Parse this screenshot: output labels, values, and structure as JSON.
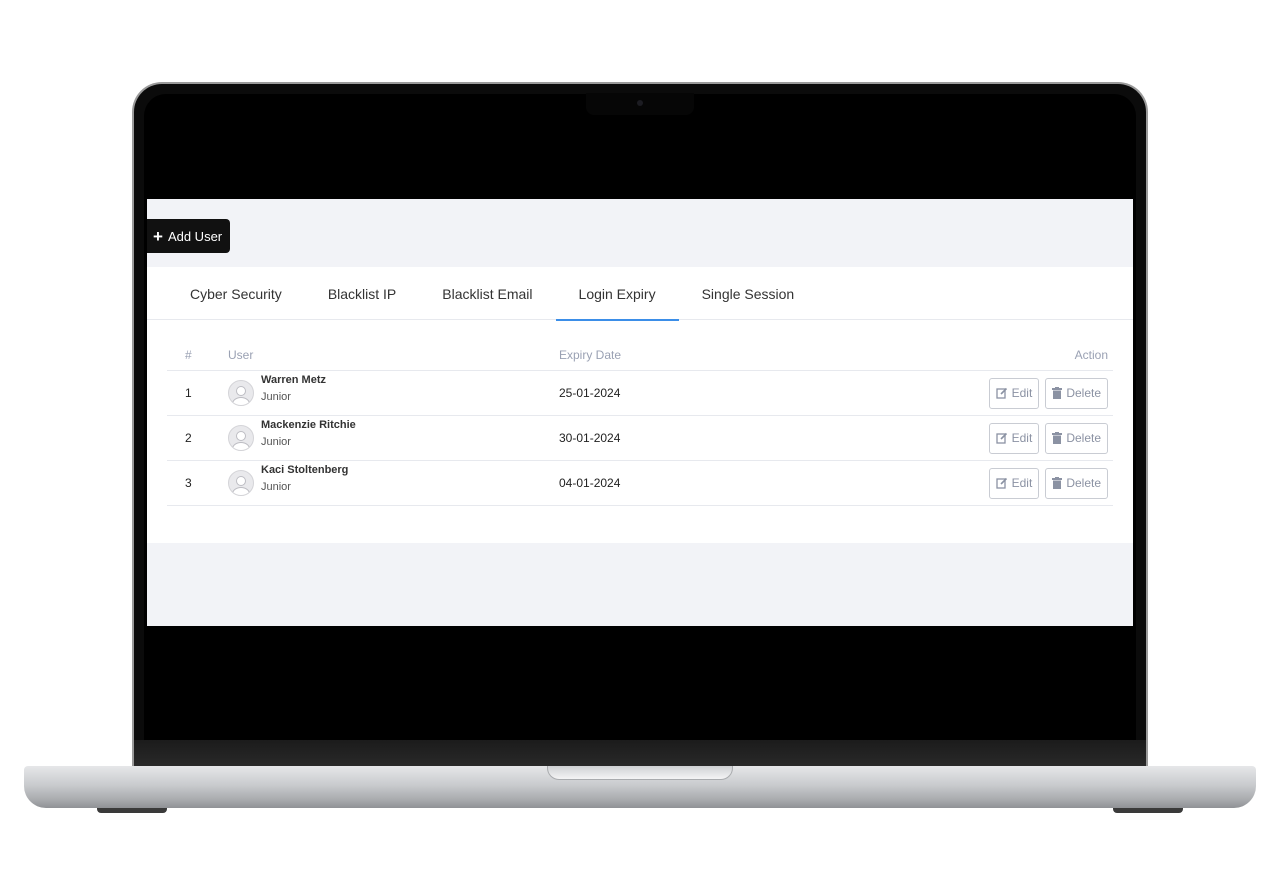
{
  "toolbar": {
    "add_user_label": "Add User",
    "add_user_icon": "plus-icon"
  },
  "tabs": [
    {
      "label": "Cyber Security",
      "active": false
    },
    {
      "label": "Blacklist IP",
      "active": false
    },
    {
      "label": "Blacklist Email",
      "active": false
    },
    {
      "label": "Login Expiry",
      "active": true
    },
    {
      "label": "Single Session",
      "active": false
    }
  ],
  "table": {
    "headers": {
      "num": "#",
      "user": "User",
      "expiry": "Expiry Date",
      "action": "Action"
    },
    "rows": [
      {
        "num": "1",
        "name": "Warren Metz",
        "role": "Junior",
        "expiry": "25-01-2024",
        "edit": "Edit",
        "delete": "Delete"
      },
      {
        "num": "2",
        "name": "Mackenzie Ritchie",
        "role": "Junior",
        "expiry": "30-01-2024",
        "edit": "Edit",
        "delete": "Delete"
      },
      {
        "num": "3",
        "name": "Kaci Stoltenberg",
        "role": "Junior",
        "expiry": "04-01-2024",
        "edit": "Edit",
        "delete": "Delete"
      }
    ]
  },
  "colors": {
    "active_tab_underline": "#3b8ee8",
    "add_button_bg": "#111111",
    "screen_bg": "#f2f3f7"
  }
}
